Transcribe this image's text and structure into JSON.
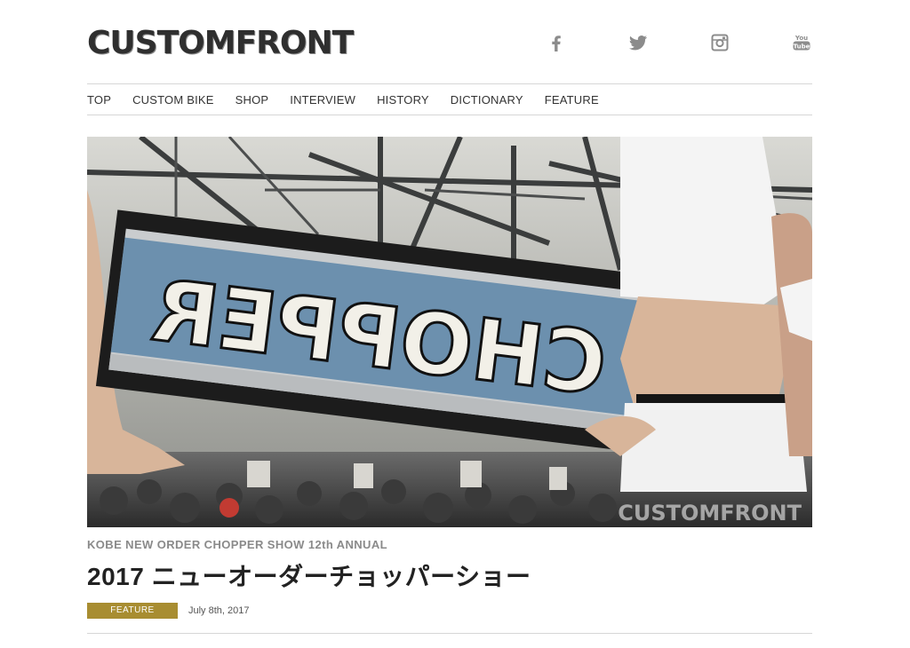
{
  "brand": {
    "logo_text": "CUSTOMFRONT"
  },
  "social": [
    {
      "name": "facebook-icon"
    },
    {
      "name": "twitter-icon"
    },
    {
      "name": "instagram-icon"
    },
    {
      "name": "youtube-icon"
    }
  ],
  "nav": {
    "items": [
      "TOP",
      "CUSTOM BIKE",
      "SHOP",
      "INTERVIEW",
      "HISTORY",
      "DICTIONARY",
      "FEATURE"
    ]
  },
  "hero": {
    "sign_text": "CHOPPER",
    "watermark": "CUSTOMFRONT"
  },
  "article": {
    "kicker": "KOBE NEW ORDER CHOPPER SHOW 12th ANNUAL",
    "title": "2017 ニューオーダーチョッパーショー",
    "category": "FEATURE",
    "date": "July 8th, 2017"
  },
  "colors": {
    "badge": "#a88d31",
    "rule": "#d6d6d6",
    "logo": "#2f2f2f"
  }
}
